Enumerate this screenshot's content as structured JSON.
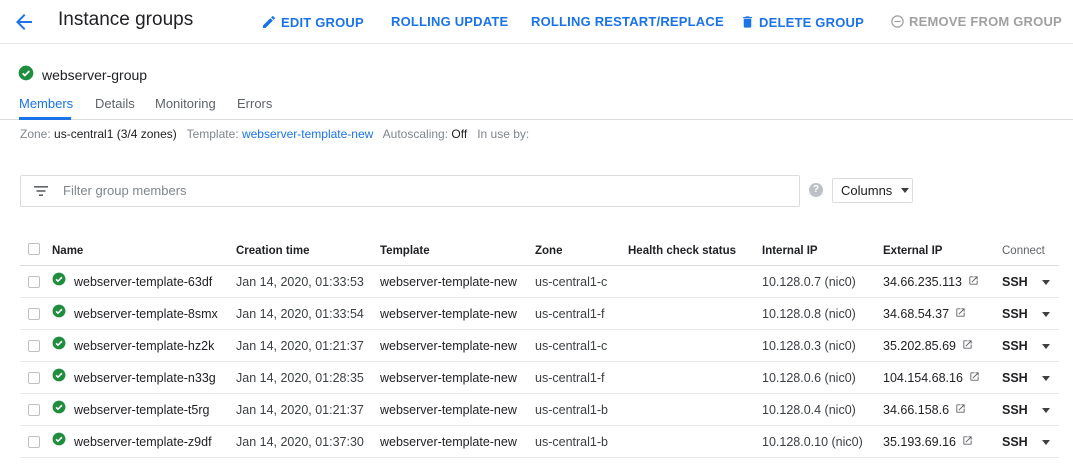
{
  "header": {
    "title": "Instance groups",
    "actions": {
      "edit": "EDIT GROUP",
      "rolling_update": "ROLLING UPDATE",
      "rolling_restart": "ROLLING RESTART/REPLACE",
      "delete": "DELETE GROUP",
      "remove": "REMOVE FROM GROUP"
    }
  },
  "group": {
    "name": "webserver-group",
    "status": "healthy"
  },
  "tabs": [
    "Members",
    "Details",
    "Monitoring",
    "Errors"
  ],
  "active_tab": "Members",
  "info": {
    "zone_label": "Zone:",
    "zone_value": "us-central1 (3/4 zones)",
    "template_label": "Template:",
    "template_value": "webserver-template-new",
    "autoscaling_label": "Autoscaling:",
    "autoscaling_value": "Off",
    "in_use_label": "In use by:"
  },
  "filter": {
    "placeholder": "Filter group members",
    "help": "?"
  },
  "columns_button": "Columns",
  "table": {
    "headers": {
      "name": "Name",
      "created": "Creation time",
      "template": "Template",
      "zone": "Zone",
      "health": "Health check status",
      "internal_ip": "Internal IP",
      "external_ip": "External IP",
      "connect": "Connect"
    },
    "rows": [
      {
        "name": "webserver-template-63df",
        "created": "Jan 14, 2020, 01:33:53",
        "template": "webserver-template-new",
        "zone": "us-central1-c",
        "health": "",
        "internal_ip": "10.128.0.7 (nic0)",
        "external_ip": "34.66.235.113",
        "connect": "SSH"
      },
      {
        "name": "webserver-template-8smx",
        "created": "Jan 14, 2020, 01:33:54",
        "template": "webserver-template-new",
        "zone": "us-central1-f",
        "health": "",
        "internal_ip": "10.128.0.8 (nic0)",
        "external_ip": "34.68.54.37",
        "connect": "SSH"
      },
      {
        "name": "webserver-template-hz2k",
        "created": "Jan 14, 2020, 01:21:37",
        "template": "webserver-template-new",
        "zone": "us-central1-c",
        "health": "",
        "internal_ip": "10.128.0.3 (nic0)",
        "external_ip": "35.202.85.69",
        "connect": "SSH"
      },
      {
        "name": "webserver-template-n33g",
        "created": "Jan 14, 2020, 01:28:35",
        "template": "webserver-template-new",
        "zone": "us-central1-f",
        "health": "",
        "internal_ip": "10.128.0.6 (nic0)",
        "external_ip": "104.154.68.16",
        "connect": "SSH"
      },
      {
        "name": "webserver-template-t5rg",
        "created": "Jan 14, 2020, 01:21:37",
        "template": "webserver-template-new",
        "zone": "us-central1-b",
        "health": "",
        "internal_ip": "10.128.0.4 (nic0)",
        "external_ip": "34.66.158.6",
        "connect": "SSH"
      },
      {
        "name": "webserver-template-z9df",
        "created": "Jan 14, 2020, 01:37:30",
        "template": "webserver-template-new",
        "zone": "us-central1-b",
        "health": "",
        "internal_ip": "10.128.0.10 (nic0)",
        "external_ip": "35.193.69.16",
        "connect": "SSH"
      }
    ]
  },
  "colors": {
    "accent": "#1a73e8",
    "healthy": "#1e8e3e",
    "disabled": "#a0a0a0"
  }
}
